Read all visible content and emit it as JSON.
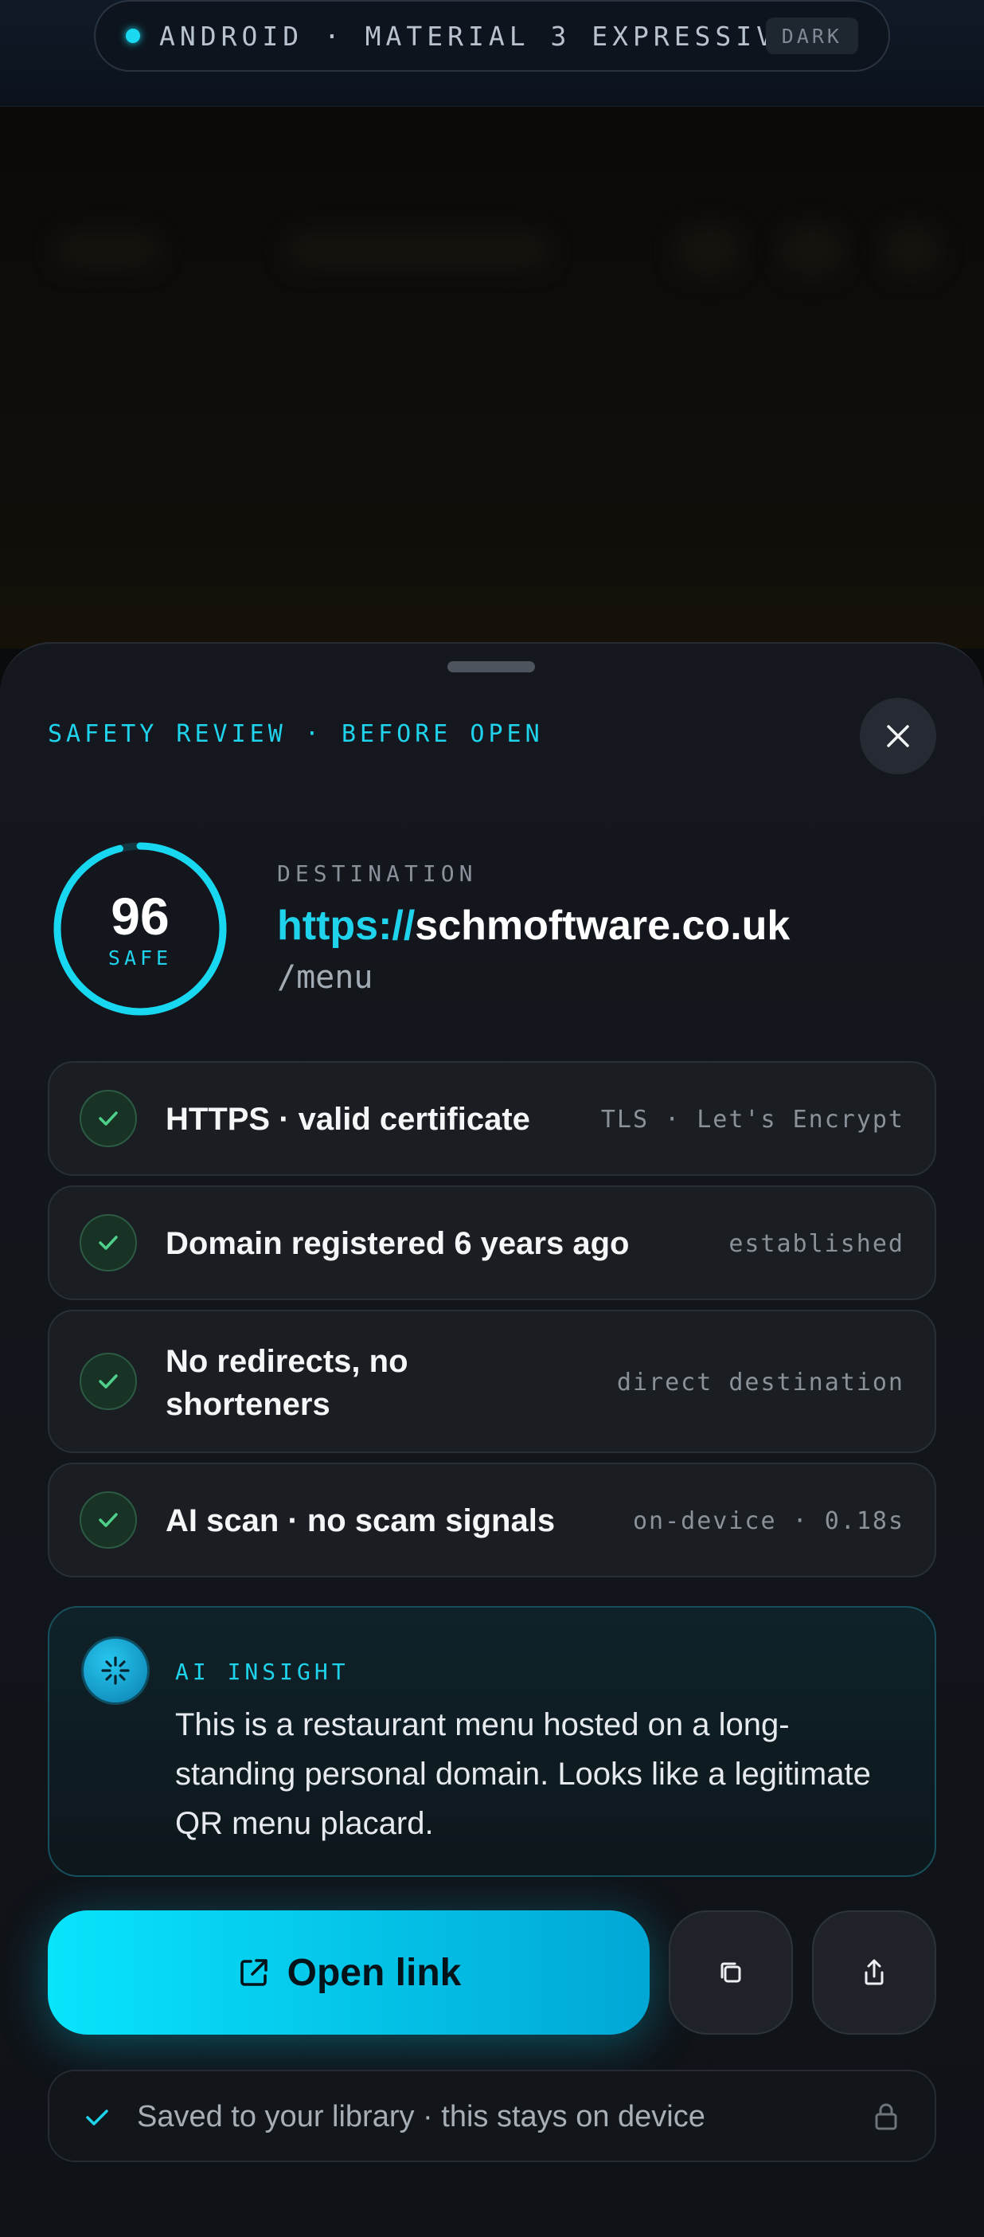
{
  "topbar": {
    "title": "ANDROID · MATERIAL 3 EXPRESSIVE",
    "badge": "DARK",
    "accent": "#1ad9f0"
  },
  "sheet": {
    "label": "SAFETY REVIEW · BEFORE OPEN",
    "close_icon": "close-icon"
  },
  "score": {
    "value": "96",
    "label": "SAFE",
    "fraction": 0.96
  },
  "destination": {
    "label": "DESTINATION",
    "scheme": "https://",
    "host": "schmoftware.co.uk",
    "path": "/menu"
  },
  "checks": [
    {
      "title": "HTTPS · valid certificate",
      "meta": "TLS · Let's Encrypt",
      "icon": "check-icon"
    },
    {
      "title": "Domain registered 6 years ago",
      "meta": "established",
      "icon": "check-icon"
    },
    {
      "title": "No redirects, no shorteners",
      "meta": "direct destination",
      "icon": "check-icon"
    },
    {
      "title": "AI scan · no scam signals",
      "meta": "on-device · 0.18s",
      "icon": "check-icon"
    }
  ],
  "insight": {
    "label": "AI INSIGHT",
    "text": "This is a restaurant menu hosted on a long-standing personal domain. Looks like a legitimate QR menu placard.",
    "icon": "sparkle-icon"
  },
  "actions": {
    "open_label": "Open link",
    "open_icon": "external-link-icon",
    "copy_icon": "copy-icon",
    "share_icon": "share-icon"
  },
  "saved": {
    "text": "Saved to your library · this stays on device",
    "check_icon": "checkmark-icon",
    "lock_icon": "lock-icon"
  },
  "colors": {
    "accent": "#1fd3ec",
    "success": "#4fd08a",
    "sheet": "#14181e"
  }
}
